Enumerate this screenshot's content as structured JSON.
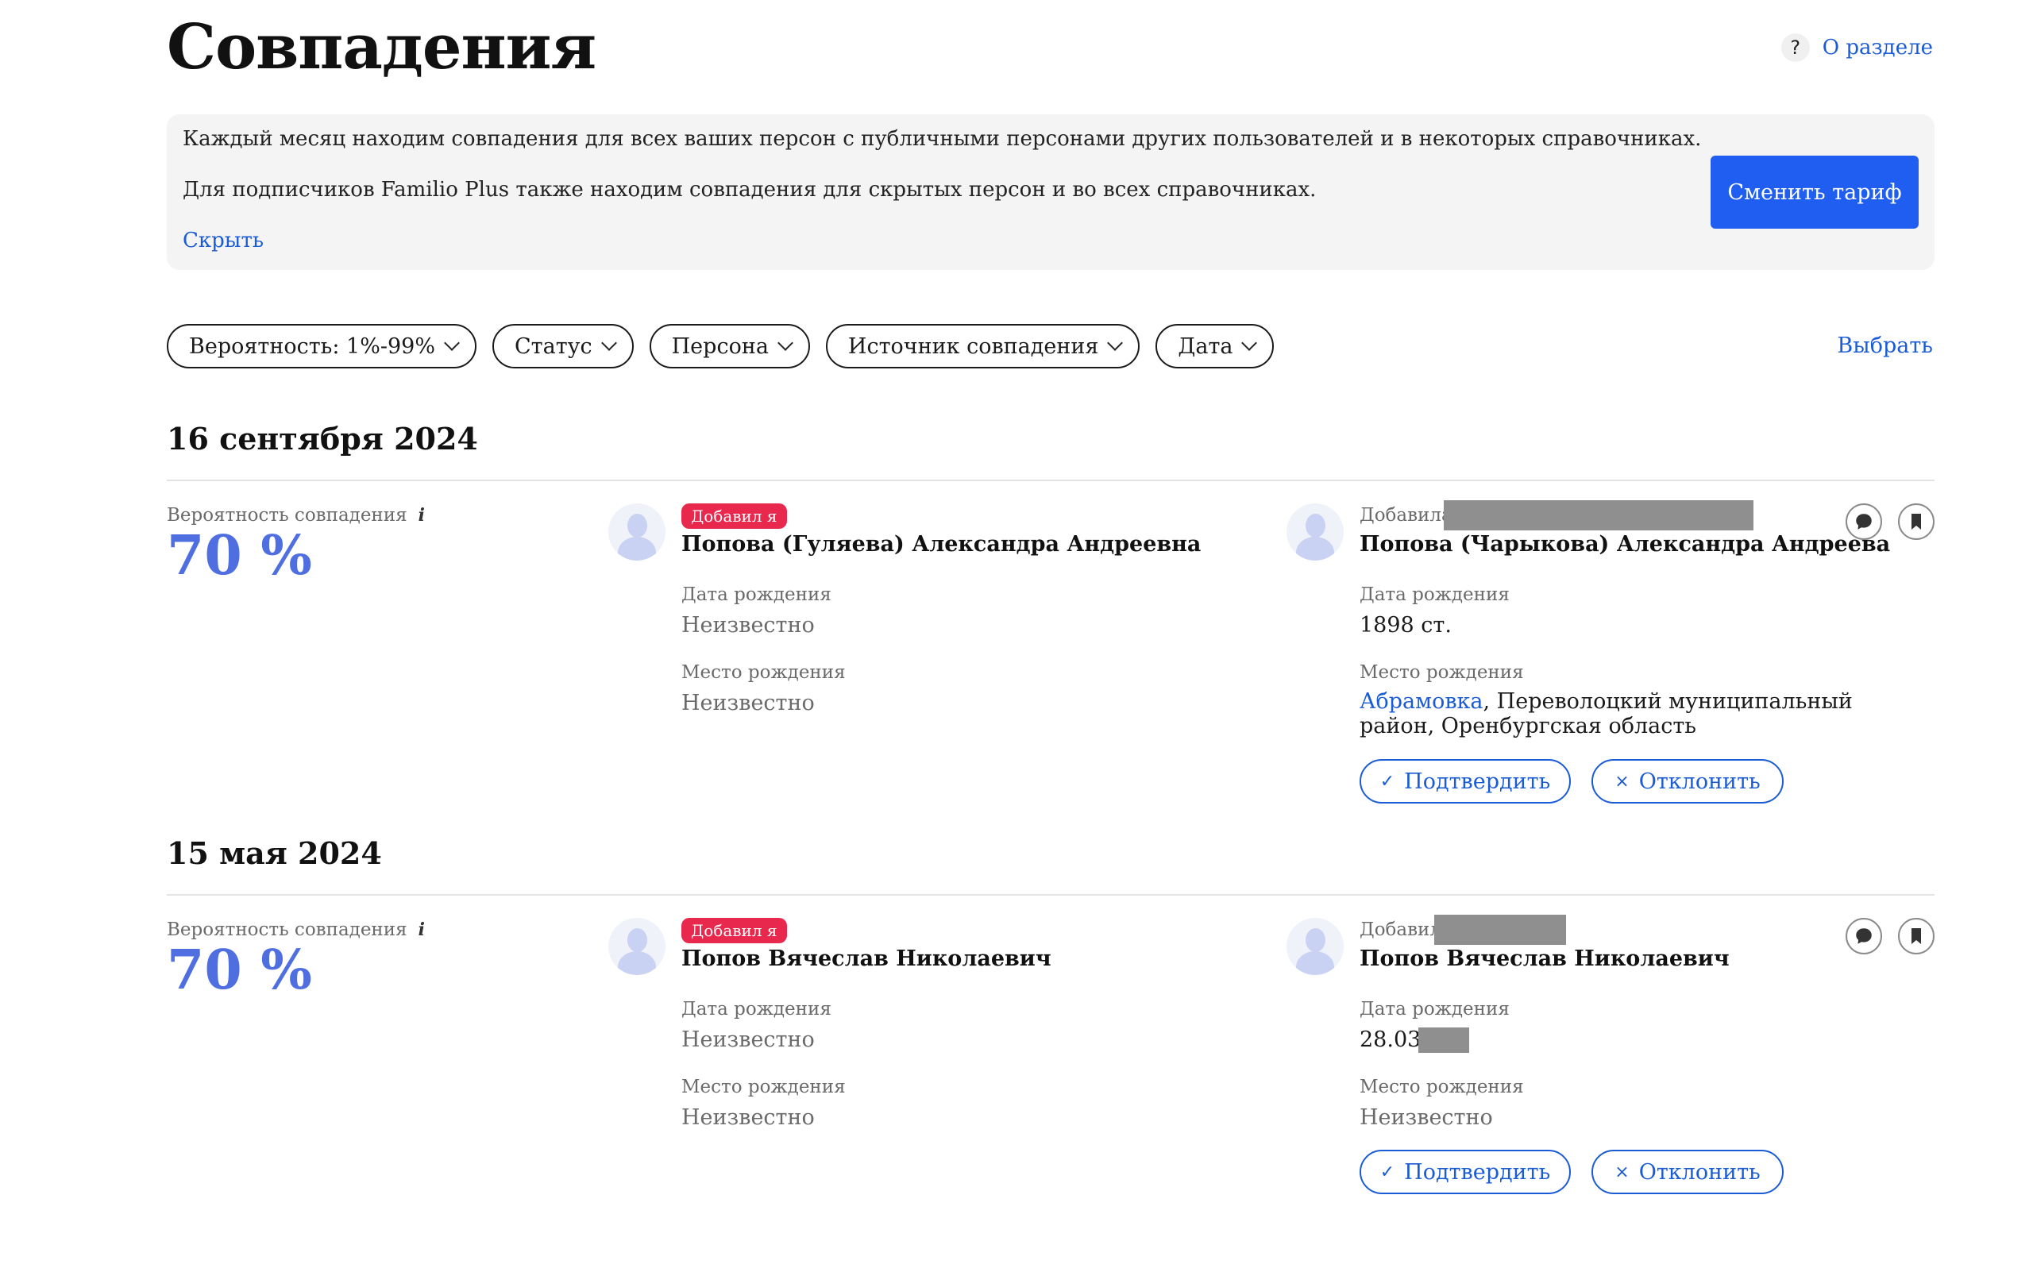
{
  "page": {
    "title": "Совпадения",
    "about_icon": "?",
    "about_link": "О разделе"
  },
  "info": {
    "line1": "Каждый месяц находим совпадения для всех ваших персон с публичными персонами других пользователей и в некоторых справочниках.",
    "line2": "Для подписчиков Familio Plus также находим совпадения для скрытых персон и во всех справочниках.",
    "hide_link": "Скрыть",
    "tariff_button": "Сменить тариф"
  },
  "filters": [
    {
      "label": "Вероятность: 1%-99%"
    },
    {
      "label": "Статус"
    },
    {
      "label": "Персона"
    },
    {
      "label": "Источник совпадения"
    },
    {
      "label": "Дата"
    }
  ],
  "select_link": "Выбрать",
  "labels": {
    "probability": "Вероятность совпадения",
    "info_icon": "i",
    "birth_date": "Дата рождения",
    "birth_place": "Место рождения",
    "confirm": "Подтвердить",
    "reject": "Отклонить",
    "confirm_glyph": "✓",
    "reject_glyph": "×"
  },
  "groups": [
    {
      "date": "16 сентября 2024",
      "probability": "70 %",
      "left": {
        "badge": "Добавил я",
        "name": "Попова (Гуляева) Александра Андреевна",
        "birth_date": "Неизвестно",
        "birth_place": "Неизвестно"
      },
      "right": {
        "added_by": "Добавила",
        "name": "Попова (Чарыкова) Александра Андреева",
        "birth_date": "1898 ст.",
        "birth_place_link": "Абрамовка",
        "birth_place_rest": ", Переволоцкий муниципальный район, Оренбургская область"
      }
    },
    {
      "date": "15 мая 2024",
      "probability": "70 %",
      "left": {
        "badge": "Добавил я",
        "name": "Попов Вячеслав Николаевич",
        "birth_date": "Неизвестно",
        "birth_place": "Неизвестно"
      },
      "right": {
        "added_by": "Добавил",
        "name": "Попов Вячеслав Николаевич",
        "birth_date": "28.03.",
        "birth_place": "Неизвестно"
      }
    }
  ]
}
